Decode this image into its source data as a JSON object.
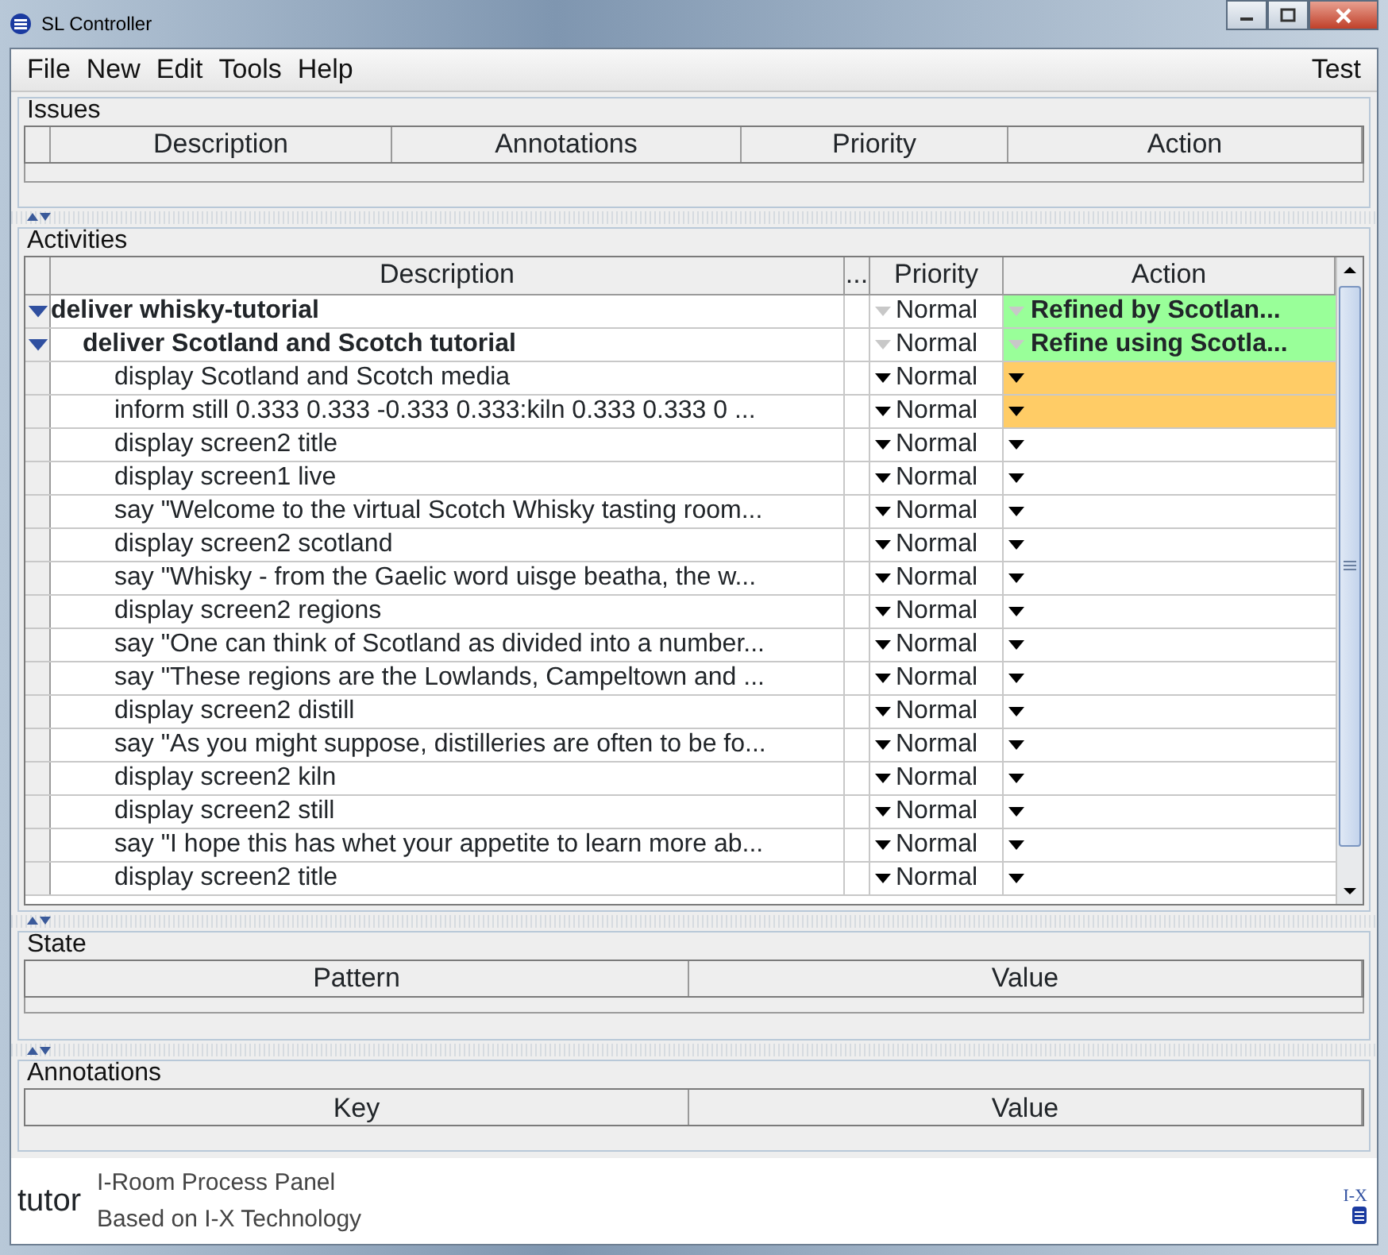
{
  "window": {
    "title": "SL Controller"
  },
  "menu": {
    "items": [
      "File",
      "New",
      "Edit",
      "Tools",
      "Help"
    ],
    "right": "Test"
  },
  "issues": {
    "title": "Issues",
    "columns": [
      "Description",
      "Annotations",
      "Priority",
      "Action"
    ]
  },
  "activities": {
    "title": "Activities",
    "columns": [
      "Description",
      "...",
      "Priority",
      "Action"
    ],
    "rows": [
      {
        "description": "deliver whisky-tutorial",
        "priority": "Normal",
        "priority_enabled": false,
        "action": "Refined by Scotlan...",
        "color": "#99ff99",
        "expanded": true,
        "children": [
          {
            "description": "deliver Scotland and Scotch tutorial",
            "priority": "Normal",
            "priority_enabled": false,
            "action": "Refine using Scotla...",
            "color": "#99ff99",
            "expanded": true,
            "children": [
              {
                "description": "display Scotland and Scotch media",
                "priority": "Normal",
                "priority_enabled": true,
                "color": "#ffcc66"
              },
              {
                "description": "inform still 0.333 0.333 -0.333 0.333:kiln 0.333 0.333 0 ...",
                "priority": "Normal",
                "priority_enabled": true,
                "color": "#ffcc66"
              },
              {
                "description": "display screen2 title",
                "priority": "Normal",
                "priority_enabled": true,
                "color": "#ffffff"
              },
              {
                "description": "display screen1 live",
                "priority": "Normal",
                "priority_enabled": true,
                "color": "#ffffff"
              },
              {
                "description": "say \"Welcome to the virtual Scotch Whisky tasting room...",
                "priority": "Normal",
                "priority_enabled": true,
                "color": "#ffffff"
              },
              {
                "description": "display screen2 scotland",
                "priority": "Normal",
                "priority_enabled": true,
                "color": "#ffffff"
              },
              {
                "description": "say \"Whisky - from the Gaelic word uisge beatha, the w...",
                "priority": "Normal",
                "priority_enabled": true,
                "color": "#ffffff"
              },
              {
                "description": "display screen2 regions",
                "priority": "Normal",
                "priority_enabled": true,
                "color": "#ffffff"
              },
              {
                "description": "say \"One can think of Scotland as divided into a number...",
                "priority": "Normal",
                "priority_enabled": true,
                "color": "#ffffff"
              },
              {
                "description": "say \"These regions are the Lowlands, Campeltown and ...",
                "priority": "Normal",
                "priority_enabled": true,
                "color": "#ffffff"
              },
              {
                "description": "display screen2 distill",
                "priority": "Normal",
                "priority_enabled": true,
                "color": "#ffffff"
              },
              {
                "description": "say \"As you might suppose, distilleries are often to be fo...",
                "priority": "Normal",
                "priority_enabled": true,
                "color": "#ffffff"
              },
              {
                "description": "display screen2 kiln",
                "priority": "Normal",
                "priority_enabled": true,
                "color": "#ffffff"
              },
              {
                "description": "display screen2 still",
                "priority": "Normal",
                "priority_enabled": true,
                "color": "#ffffff"
              },
              {
                "description": "say \"I hope this has whet your appetite to learn more ab...",
                "priority": "Normal",
                "priority_enabled": true,
                "color": "#ffffff"
              },
              {
                "description": "display screen2 title",
                "priority": "Normal",
                "priority_enabled": true,
                "color": "#ffffff"
              }
            ]
          }
        ]
      }
    ]
  },
  "state": {
    "title": "State",
    "columns": [
      "Pattern",
      "Value"
    ]
  },
  "annotations": {
    "title": "Annotations",
    "columns": [
      "Key",
      "Value"
    ]
  },
  "footer": {
    "user": "tutor",
    "lines": [
      "I-Room Process Panel",
      "Based on I-X Technology"
    ],
    "logo_text": "I-X"
  }
}
